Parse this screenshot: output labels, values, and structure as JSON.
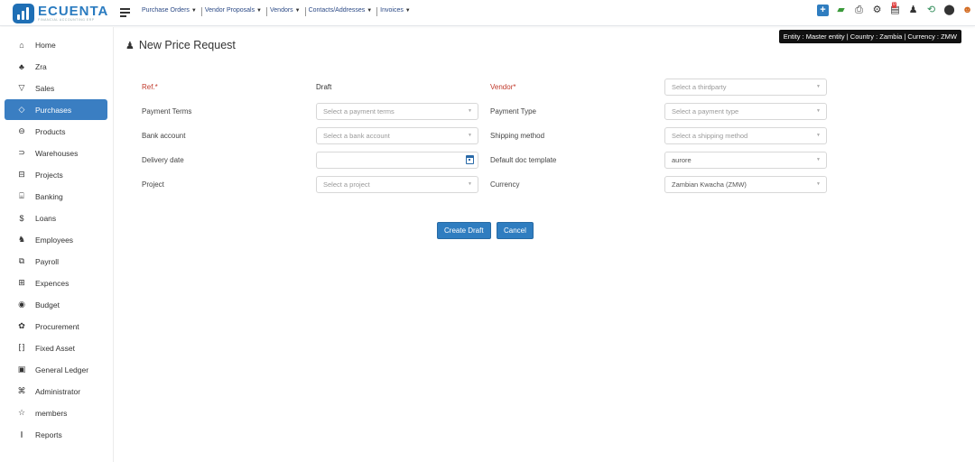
{
  "app": {
    "logo_text": "ECUENTA",
    "logo_tagline": "FINANCIAL ACCOUNTING ERP"
  },
  "topmenu": [
    {
      "label": "Purchase Orders"
    },
    {
      "label": "Vendor Proposals"
    },
    {
      "label": "Vendors"
    },
    {
      "label": "Contacts/Addresses"
    },
    {
      "label": "Invoices"
    }
  ],
  "topicons": [
    "plus-square-icon",
    "chat-icon",
    "printer-icon",
    "gear-icon",
    "notepad-badge-icon",
    "bell-icon",
    "history-icon",
    "location-pin-icon",
    "user-avatar-icon"
  ],
  "notepad_badge": "0",
  "entity_banner": "Entity : Master entity | Country : Zambia | Currency : ZMW",
  "sidebar": {
    "items": [
      {
        "label": "Home",
        "icon": "home-icon"
      },
      {
        "label": "Zra",
        "icon": "group-icon"
      },
      {
        "label": "Sales",
        "icon": "cart-icon"
      },
      {
        "label": "Purchases",
        "icon": "bag-icon",
        "active": true
      },
      {
        "label": "Products",
        "icon": "box-icon"
      },
      {
        "label": "Warehouses",
        "icon": "dolly-icon"
      },
      {
        "label": "Projects",
        "icon": "briefcase-icon"
      },
      {
        "label": "Banking",
        "icon": "bank-icon"
      },
      {
        "label": "Loans",
        "icon": "dollar-circle-icon"
      },
      {
        "label": "Employees",
        "icon": "users-icon"
      },
      {
        "label": "Payroll",
        "icon": "payroll-icon"
      },
      {
        "label": "Expences",
        "icon": "receipt-icon"
      },
      {
        "label": "Budget",
        "icon": "coins-icon"
      },
      {
        "label": "Procurement",
        "icon": "procurement-icon"
      },
      {
        "label": "Fixed Asset",
        "icon": "asset-icon"
      },
      {
        "label": "General Ledger",
        "icon": "ledger-icon"
      },
      {
        "label": "Administrator",
        "icon": "admin-icon"
      },
      {
        "label": "members",
        "icon": "star-icon"
      },
      {
        "label": "Reports",
        "icon": "bar-chart-icon"
      }
    ]
  },
  "page": {
    "title": "New Price Request"
  },
  "form": {
    "ref": {
      "label": "Ref.*",
      "value": "Draft"
    },
    "vendor": {
      "label": "Vendor*",
      "placeholder": "Select a thirdparty"
    },
    "payment_terms": {
      "label": "Payment Terms",
      "placeholder": "Select a payment terms"
    },
    "payment_type": {
      "label": "Payment Type",
      "placeholder": "Select a payment type"
    },
    "bank_account": {
      "label": "Bank account",
      "placeholder": "Select a bank account"
    },
    "shipping_method": {
      "label": "Shipping method",
      "placeholder": "Select a shipping method"
    },
    "delivery_date": {
      "label": "Delivery date",
      "value": ""
    },
    "doc_template": {
      "label": "Default doc template",
      "value": "aurore"
    },
    "project": {
      "label": "Project",
      "placeholder": "Select a project"
    },
    "currency": {
      "label": "Currency",
      "value": "Zambian Kwacha (ZMW)"
    }
  },
  "buttons": {
    "create": "Create Draft",
    "cancel": "Cancel"
  }
}
